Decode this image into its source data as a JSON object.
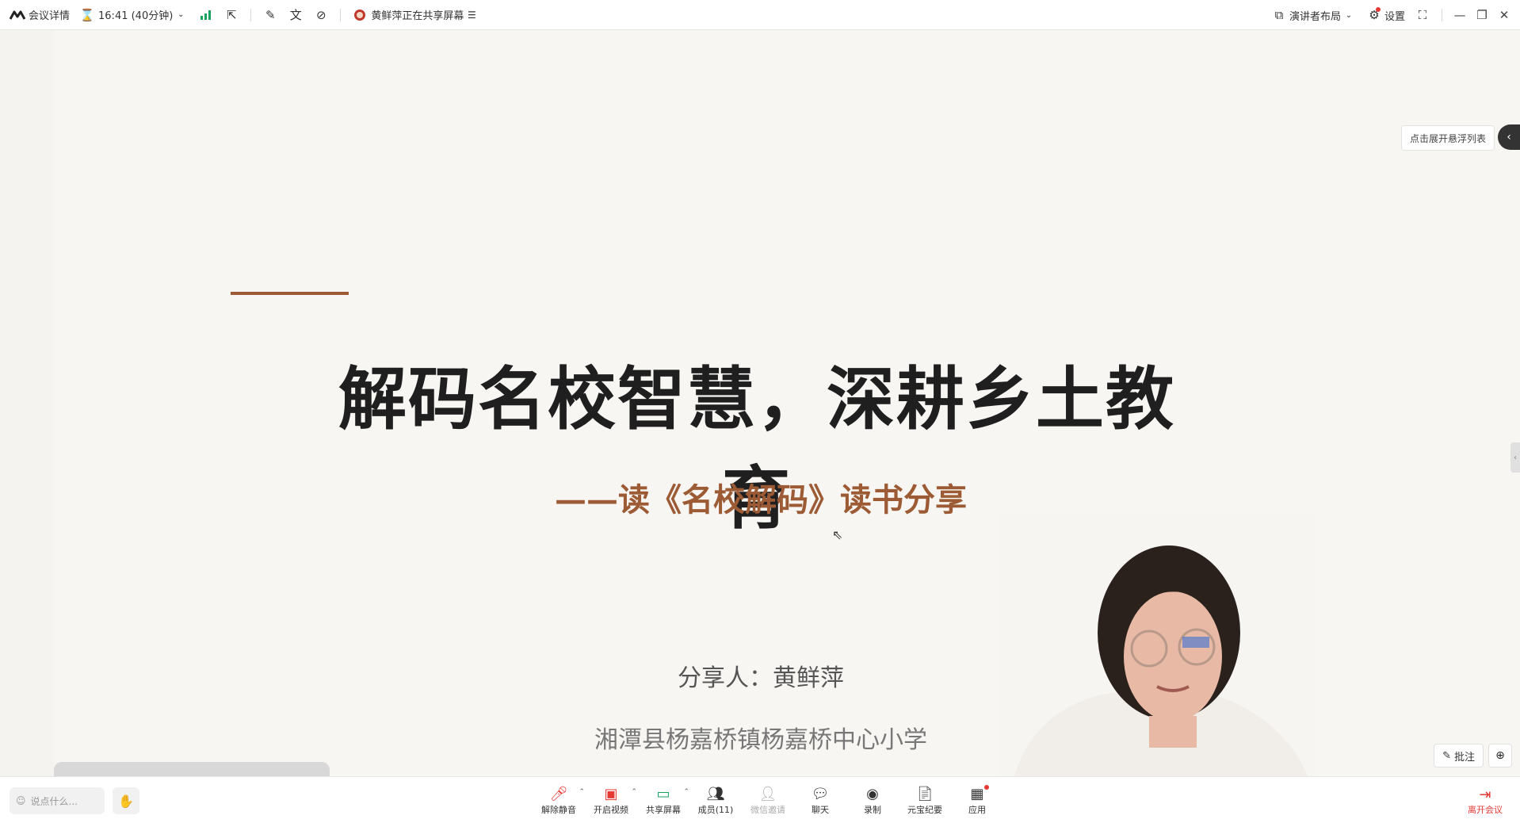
{
  "topbar": {
    "meeting_details": "会议详情",
    "timer": "16:41 (40分钟)",
    "sharing_status": "黄鲜萍正在共享屏幕",
    "layout_label": "演讲者布局",
    "settings_label": "设置"
  },
  "slide": {
    "title": "解码名校智慧，深耕乡土教育",
    "subtitle": "——读《名校解码》读书分享",
    "presenter": "分享人：黄鲜萍",
    "school": "湘潭县杨嘉桥镇杨嘉桥中心小学",
    "accent_color": "#9c5b34"
  },
  "overlay": {
    "float_list_label": "点击展开悬浮列表",
    "annotate_label": "批注"
  },
  "bottombar": {
    "chat_placeholder": "说点什么...",
    "tools": [
      {
        "label": "解除静音",
        "icon": "mic-muted-icon"
      },
      {
        "label": "开启视频",
        "icon": "video-off-icon"
      },
      {
        "label": "共享屏幕",
        "icon": "share-screen-icon"
      },
      {
        "label": "成员(11)",
        "icon": "members-icon"
      },
      {
        "label": "微信邀请",
        "icon": "wechat-invite-icon"
      },
      {
        "label": "聊天",
        "icon": "chat-icon"
      },
      {
        "label": "录制",
        "icon": "record-icon"
      },
      {
        "label": "元宝纪要",
        "icon": "minutes-icon"
      },
      {
        "label": "应用",
        "icon": "apps-icon"
      }
    ],
    "leave_label": "离开会议"
  }
}
